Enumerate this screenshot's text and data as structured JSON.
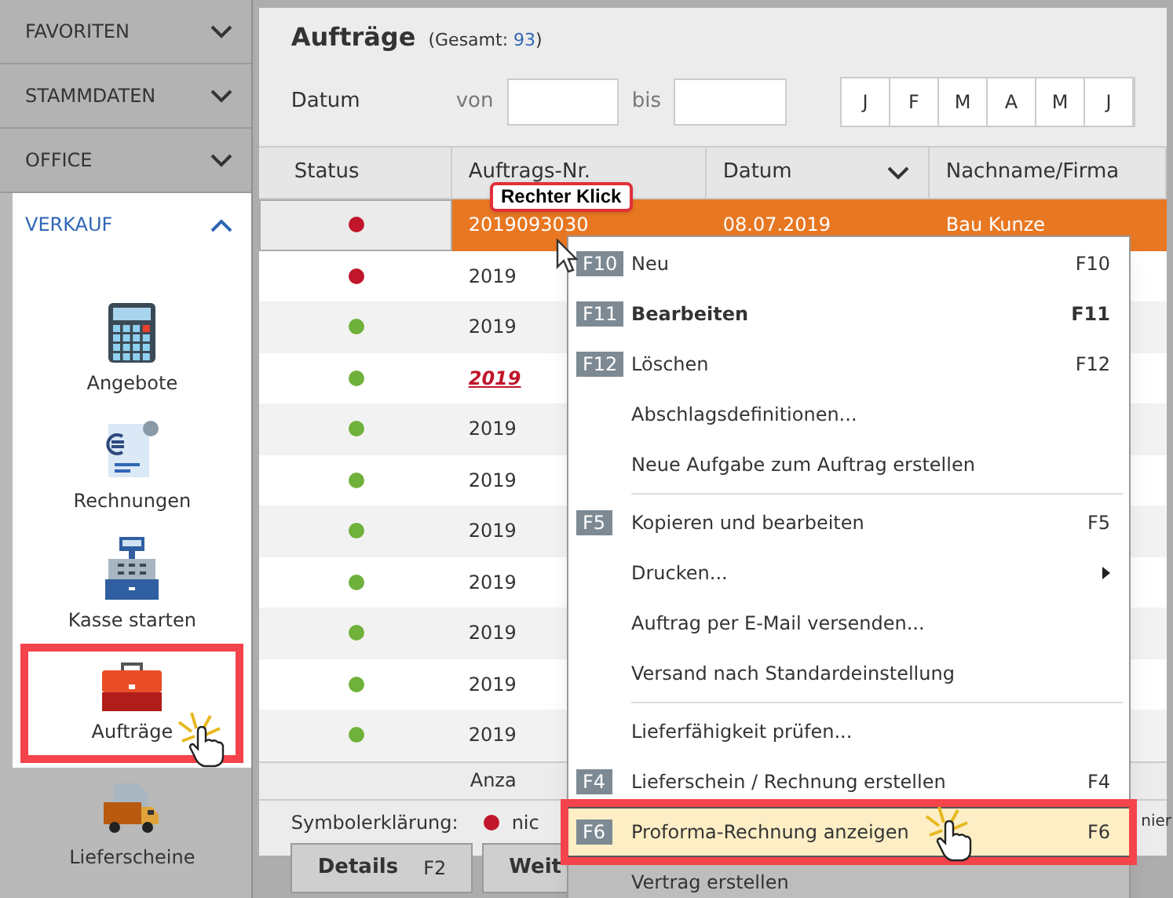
{
  "sidebar": {
    "sections": [
      {
        "label": "FAVORITEN",
        "expanded": false
      },
      {
        "label": "STAMMDATEN",
        "expanded": false
      },
      {
        "label": "OFFICE",
        "expanded": false
      },
      {
        "label": "VERKAUF",
        "expanded": true
      }
    ],
    "items": [
      {
        "label": "Angebote",
        "kind": "calculator",
        "selected": false
      },
      {
        "label": "Rechnungen",
        "kind": "invoice",
        "selected": false
      },
      {
        "label": "Kasse starten",
        "kind": "register",
        "selected": false
      },
      {
        "label": "Aufträge",
        "kind": "briefcase",
        "selected": true
      },
      {
        "label": "Lieferscheine",
        "kind": "truck",
        "selected": false
      }
    ]
  },
  "title": "Aufträge",
  "total_label": "(Gesamt:",
  "total": "93",
  "total_close": ")",
  "filter": {
    "label": "Datum",
    "from_label": "von",
    "to_label": "bis",
    "months": [
      {
        "label": "J",
        "selected": false
      },
      {
        "label": "F",
        "selected": false
      },
      {
        "label": "M",
        "selected": false
      },
      {
        "label": "A",
        "selected": false
      },
      {
        "label": "M",
        "selected": false
      },
      {
        "label": "J",
        "selected": false
      }
    ]
  },
  "table": {
    "columns": [
      "Status",
      "Auftrags-Nr.",
      "Datum",
      "Nachname/Firma"
    ],
    "rows": [
      {
        "color": "#c0152a",
        "number": "2019093030",
        "date": "08.07.2019",
        "name": "Bau Kunze",
        "selected": true,
        "emphasized": false
      },
      {
        "color": "#c0152a",
        "number": "2019",
        "selected": false,
        "emphasized": false
      },
      {
        "color": "#6fb13a",
        "number": "2019",
        "selected": false,
        "emphasized": false
      },
      {
        "color": "#6fb13a",
        "number": "2019",
        "selected": false,
        "emphasized": true
      },
      {
        "color": "#6fb13a",
        "number": "2019",
        "selected": false,
        "emphasized": false
      },
      {
        "color": "#6fb13a",
        "number": "2019",
        "selected": false,
        "emphasized": false
      },
      {
        "color": "#6fb13a",
        "number": "2019",
        "selected": false,
        "emphasized": false
      },
      {
        "color": "#6fb13a",
        "number": "2019",
        "selected": false,
        "emphasized": false
      },
      {
        "color": "#6fb13a",
        "number": "2019",
        "selected": false,
        "emphasized": false
      },
      {
        "color": "#6fb13a",
        "number": "2019",
        "selected": false,
        "emphasized": false
      },
      {
        "color": "#6fb13a",
        "number": "2019",
        "selected": false,
        "emphasized": false
      }
    ],
    "count_label": "Anza"
  },
  "legend": {
    "label": "Symbolerklärung:",
    "color": "#c0152a",
    "text": "nic",
    "text_right": "nier"
  },
  "buttons": [
    {
      "label": "Details",
      "key": "F2"
    },
    {
      "label": "Weit"
    }
  ],
  "tooltip": "Rechter Klick",
  "context_menu": [
    {
      "kind": "item",
      "badge": "F10",
      "label": "Neu",
      "shortcut": "F10",
      "bold": false,
      "selected": false
    },
    {
      "kind": "item",
      "badge": "F11",
      "label": "Bearbeiten",
      "shortcut": "F11",
      "bold": true,
      "selected": false
    },
    {
      "kind": "item",
      "badge": "F12",
      "label": "Löschen",
      "shortcut": "F12",
      "bold": false,
      "selected": false
    },
    {
      "kind": "item",
      "label": "Abschlagsdefinitionen...",
      "bold": false,
      "selected": false
    },
    {
      "kind": "item",
      "label": "Neue Aufgabe zum Auftrag erstellen",
      "bold": false,
      "selected": false
    },
    {
      "kind": "separator"
    },
    {
      "kind": "item",
      "badge": "F5",
      "label": "Kopieren und bearbeiten",
      "shortcut": "F5",
      "bold": false,
      "selected": false
    },
    {
      "kind": "submenu",
      "label": "Drucken...",
      "bold": false,
      "selected": false
    },
    {
      "kind": "item",
      "label": "Auftrag per E-Mail versenden...",
      "bold": false,
      "selected": false
    },
    {
      "kind": "item",
      "label": "Versand nach Standardeinstellung",
      "bold": false,
      "selected": false
    },
    {
      "kind": "separator"
    },
    {
      "kind": "item",
      "label": "Lieferfähigkeit prüfen...",
      "bold": false,
      "selected": false
    },
    {
      "kind": "item",
      "badge": "F4",
      "label": "Lieferschein / Rechnung erstellen",
      "shortcut": "F4",
      "bold": false,
      "selected": false
    },
    {
      "kind": "item",
      "badge": "F6",
      "label": "Proforma-Rechnung anzeigen",
      "shortcut": "F6",
      "bold": false,
      "selected": true
    },
    {
      "kind": "item",
      "label": "Vertrag erstellen",
      "bold": false,
      "selected": false,
      "dimmed": true
    }
  ]
}
